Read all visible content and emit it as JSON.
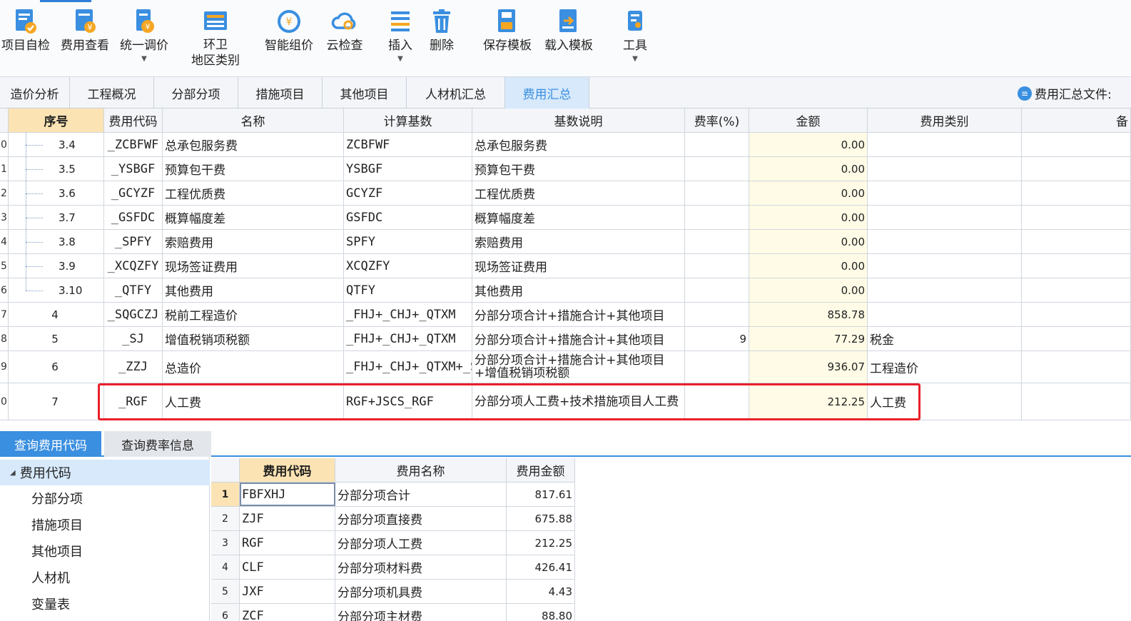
{
  "toolbar": {
    "items": [
      {
        "label": "项目自检",
        "icon": "check-doc-icon",
        "dropdown": false
      },
      {
        "label": "费用查看",
        "icon": "fee-view-icon",
        "dropdown": false
      },
      {
        "label": "统一调价",
        "icon": "price-adjust-icon",
        "dropdown": true
      },
      {
        "label": "环卫",
        "label2": "地区类别",
        "icon": "sanitation-icon",
        "dropdown": false
      },
      {
        "label": "智能组价",
        "icon": "smart-pricing-icon",
        "dropdown": false
      },
      {
        "label": "云检查",
        "icon": "cloud-check-icon",
        "dropdown": false
      },
      {
        "label": "插入",
        "icon": "insert-icon",
        "dropdown": true
      },
      {
        "label": "删除",
        "icon": "delete-icon",
        "dropdown": false
      },
      {
        "label": "保存模板",
        "icon": "save-template-icon",
        "dropdown": false
      },
      {
        "label": "载入模板",
        "icon": "load-template-icon",
        "dropdown": false
      },
      {
        "label": "工具",
        "icon": "tools-icon",
        "dropdown": true
      }
    ],
    "accent_color": "#2f7fd8"
  },
  "tabs": {
    "items": [
      "造价分析",
      "工程概况",
      "分部分项",
      "措施项目",
      "其他项目",
      "人材机汇总",
      "费用汇总"
    ],
    "active": "费用汇总",
    "file_label": "费用汇总文件:"
  },
  "grid": {
    "headers": [
      "序号",
      "费用代码",
      "名称",
      "计算基数",
      "基数说明",
      "费率(%)",
      "金额",
      "费用类别",
      "备"
    ],
    "rows": [
      {
        "rn": "0",
        "seq": "3.4",
        "code": "_ZCBFWF",
        "name": "总承包服务费",
        "base": "ZCBFWF",
        "desc": "总承包服务费",
        "rate": "",
        "amount": "0.00",
        "category": ""
      },
      {
        "rn": "1",
        "seq": "3.5",
        "code": "_YSBGF",
        "name": "预算包干费",
        "base": "YSBGF",
        "desc": "预算包干费",
        "rate": "",
        "amount": "0.00",
        "category": ""
      },
      {
        "rn": "2",
        "seq": "3.6",
        "code": "_GCYZF",
        "name": "工程优质费",
        "base": "GCYZF",
        "desc": "工程优质费",
        "rate": "",
        "amount": "0.00",
        "category": ""
      },
      {
        "rn": "3",
        "seq": "3.7",
        "code": "_GSFDC",
        "name": "概算幅度差",
        "base": "GSFDC",
        "desc": "概算幅度差",
        "rate": "",
        "amount": "0.00",
        "category": ""
      },
      {
        "rn": "4",
        "seq": "3.8",
        "code": "_SPFY",
        "name": "索赔费用",
        "base": "SPFY",
        "desc": "索赔费用",
        "rate": "",
        "amount": "0.00",
        "category": ""
      },
      {
        "rn": "5",
        "seq": "3.9",
        "code": "_XCQZFY",
        "name": "现场签证费用",
        "base": "XCQZFY",
        "desc": "现场签证费用",
        "rate": "",
        "amount": "0.00",
        "category": ""
      },
      {
        "rn": "6",
        "seq": "3.10",
        "code": "_QTFY",
        "name": "其他费用",
        "base": "QTFY",
        "desc": "其他费用",
        "rate": "",
        "amount": "0.00",
        "category": ""
      },
      {
        "rn": "7",
        "seq": "4",
        "code": "_SQGCZJ",
        "name": "税前工程造价",
        "base": "_FHJ+_CHJ+_QTXM",
        "desc": "分部分项合计+措施合计+其他项目",
        "rate": "",
        "amount": "858.78",
        "category": ""
      },
      {
        "rn": "8",
        "seq": "5",
        "code": "_SJ",
        "name": "增值税销项税额",
        "base": "_FHJ+_CHJ+_QTXM",
        "desc": "分部分项合计+措施合计+其他项目",
        "rate": "9",
        "amount": "77.29",
        "category": "税金"
      },
      {
        "rn": "9",
        "seq": "6",
        "code": "_ZZJ",
        "name": "总造价",
        "base": "_FHJ+_CHJ+_QTXM+_SJ",
        "desc": "分部分项合计+措施合计+其他项目+增值税销项税额",
        "rate": "",
        "amount": "936.07",
        "category": "工程造价"
      },
      {
        "rn": "0",
        "seq": "7",
        "code": "_RGF",
        "name": "人工费",
        "base": "RGF+JSCS_RGF",
        "desc": "分部分项人工费+技术措施项目人工费",
        "rate": "",
        "amount": "212.25",
        "category": "人工费"
      }
    ],
    "highlight_color": "#e8202a"
  },
  "bottom": {
    "tabs": [
      "查询费用代码",
      "查询费率信息"
    ],
    "active_tab": "查询费用代码",
    "tree": {
      "root": "费用代码",
      "items": [
        "分部分项",
        "措施项目",
        "其他项目",
        "人材机",
        "变量表"
      ]
    },
    "codes": {
      "headers": [
        "费用代码",
        "费用名称",
        "费用金额"
      ],
      "rows": [
        {
          "idx": "1",
          "code": "FBFXHJ",
          "name": "分部分项合计",
          "amount": "817.61"
        },
        {
          "idx": "2",
          "code": "ZJF",
          "name": "分部分项直接费",
          "amount": "675.88"
        },
        {
          "idx": "3",
          "code": "RGF",
          "name": "分部分项人工费",
          "amount": "212.25"
        },
        {
          "idx": "4",
          "code": "CLF",
          "name": "分部分项材料费",
          "amount": "426.41"
        },
        {
          "idx": "5",
          "code": "JXF",
          "name": "分部分项机具费",
          "amount": "4.43"
        },
        {
          "idx": "6",
          "code": "ZCF",
          "name": "分部分项主材费",
          "amount": "88.80"
        }
      ]
    }
  }
}
